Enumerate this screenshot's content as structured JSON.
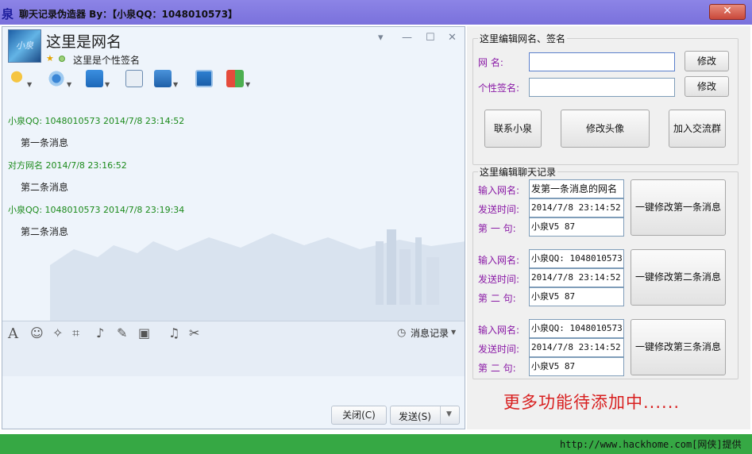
{
  "window": {
    "icon_char": "泉",
    "title": "聊天记录伪造器   By：【小泉QQ：1048010573】",
    "close": "✕"
  },
  "chat": {
    "avatar_text": "小泉",
    "name": "这里是网名",
    "signature": "这里是个性签名",
    "messages": [
      {
        "header": "小泉QQ: 1048010573 2014/7/8 23:14:52",
        "body": "第一条消息"
      },
      {
        "header": "对方网名 2014/7/8 23:16:52",
        "body": "第二条消息"
      },
      {
        "header": "小泉QQ: 1048010573 2014/7/8 23:19:34",
        "body": "第二条消息"
      }
    ],
    "history_label": "消息记录",
    "close_label": "关闭(C)",
    "send_label": "发送(S)",
    "toolbar_icons": [
      "microphone-icon",
      "camera-icon",
      "file-transfer-icon",
      "add-chat-icon",
      "remote-desktop-icon",
      "screen-share-icon",
      "apps-icon"
    ],
    "input_icons": [
      "font-icon",
      "emoji-icon",
      "nudge-icon",
      "screenshot-icon",
      "voice-icon",
      "edit-icon",
      "image-icon",
      "music-icon",
      "scissors-icon"
    ]
  },
  "profile_editor": {
    "group_label": "这里编辑网名、签名",
    "name_label": "网    名:",
    "name_value": "",
    "sig_label": "个性签名:",
    "sig_value": "",
    "modify_label": "修改",
    "buttons": [
      "联系小泉",
      "修改头像",
      "加入交流群"
    ]
  },
  "record_editor": {
    "group_label": "这里编辑聊天记录",
    "entries": [
      {
        "name_label": "输入网名:",
        "name_value": "发第一条消息的网名",
        "time_label": "发送时间:",
        "time_value": "2014/7/8 23:14:52",
        "text_label": "第 一 句:",
        "text_value": "小泉V5 87",
        "button": "一键修改第一条消息"
      },
      {
        "name_label": "输入网名:",
        "name_value": "小泉QQ: 1048010573",
        "time_label": "发送时间:",
        "time_value": "2014/7/8 23:14:52",
        "text_label": "第 二 句:",
        "text_value": "小泉V5 87",
        "button": "一键修改第二条消息"
      },
      {
        "name_label": "输入网名:",
        "name_value": "小泉QQ: 1048010573",
        "time_label": "发送时间:",
        "time_value": "2014/7/8 23:14:52",
        "text_label": "第 二 句:",
        "text_value": "小泉V5 87",
        "button": "一键修改第三条消息"
      }
    ]
  },
  "more_text": "更多功能待添加中......",
  "footer_text": "http://www.hackhome.com[网侠]提供",
  "colors": {
    "titlebar": "#7a71dc",
    "footer": "#36a844",
    "accent_text": "#d81e1e",
    "label_purple": "#8a1aa6",
    "message_header": "#1b8a1b"
  }
}
